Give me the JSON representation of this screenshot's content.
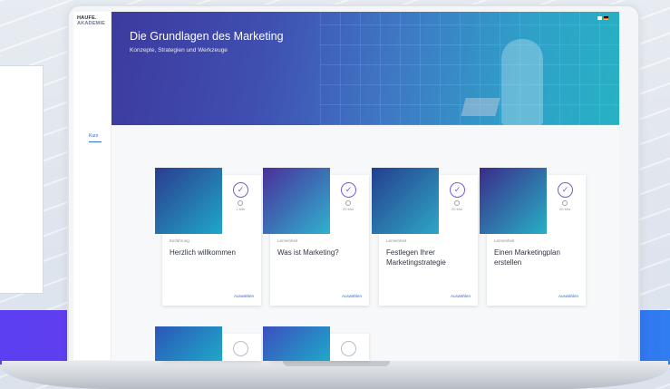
{
  "logo": {
    "line1": "HAUFE.",
    "line2": "AKADEMIE"
  },
  "hero": {
    "title": "Die Grundlagen des Marketing",
    "subtitle": "Konzepte, Strategien und Werkzeuge"
  },
  "tabs": [
    {
      "label": "Kurs"
    }
  ],
  "cards": [
    {
      "type": "Einführung",
      "title": "Herzlich willkommen",
      "duration": "1 Min",
      "action": "Auswählen",
      "thumb_colors": [
        "#2b3c8f",
        "#1fa8c8"
      ]
    },
    {
      "type": "Lerneinheit",
      "title": "Was ist Marketing?",
      "duration": "20 Min",
      "action": "Auswählen",
      "thumb_colors": [
        "#4a2f9a",
        "#2fb2cf"
      ]
    },
    {
      "type": "Lerneinheit",
      "title": "Festlegen Ihrer Marketingstrategie",
      "duration": "20 Min",
      "action": "Auswählen",
      "thumb_colors": [
        "#243f8e",
        "#2ea6c6"
      ]
    },
    {
      "type": "Lerneinheit",
      "title": "Einen Marketingplan erstellen",
      "duration": "20 Min",
      "action": "Auswählen",
      "thumb_colors": [
        "#3a2c8a",
        "#27b0c4"
      ]
    }
  ],
  "colors": {
    "accent": "#2f6fd6",
    "check": "#6f5ce0",
    "hero_start": "#3d3a9e",
    "hero_end": "#27b1c4"
  }
}
